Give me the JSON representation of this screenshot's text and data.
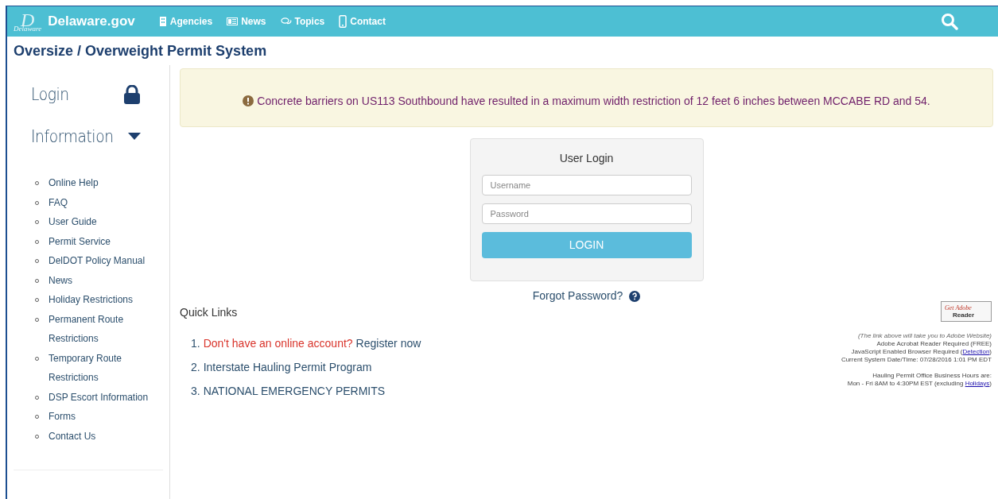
{
  "header": {
    "brand_mark": "D",
    "brand_sub": "Delaware",
    "brand": "Delaware.gov",
    "nav": [
      {
        "label": "Agencies"
      },
      {
        "label": "News"
      },
      {
        "label": "Topics"
      },
      {
        "label": "Contact"
      }
    ]
  },
  "page_title": "Oversize / Overweight Permit System",
  "sidebar": {
    "sections": [
      {
        "label": "Login"
      },
      {
        "label": "Information"
      }
    ],
    "items": [
      "Online Help",
      "FAQ",
      "User Guide",
      "Permit Service",
      "DelDOT Policy Manual",
      "News",
      "Holiday Restrictions",
      "Permanent Route Restrictions",
      "Temporary Route Restrictions",
      "DSP Escort Information",
      "Forms",
      "Contact Us"
    ]
  },
  "alert": {
    "text": "Concrete barriers on US113 Southbound have resulted in a maximum width restriction of 12 feet 6 inches between MCCABE RD and 54."
  },
  "login": {
    "title": "User Login",
    "username_placeholder": "Username",
    "password_placeholder": "Password",
    "button": "LOGIN",
    "forgot": "Forgot Password?"
  },
  "quick_links": {
    "title": "Quick Links",
    "items": [
      {
        "number": "1.",
        "prompt": "Don't have an online account?",
        "link": "Register now"
      },
      {
        "number": "2.",
        "link": "Interstate Hauling Permit Program"
      },
      {
        "number": "3.",
        "link": "NATIONAL EMERGENCY PERMITS"
      }
    ]
  },
  "adobe": {
    "badge_top": "Get Adobe",
    "badge_bottom": "Reader",
    "note": "(The link above will take you to Adobe Website)",
    "lines": [
      {
        "text": "Adobe Acrobat Reader Required (FREE)"
      },
      {
        "text": "JavaScript Enabled Browser Required (",
        "link": "Detection",
        "after": ")"
      },
      {
        "text": "Current System Date/Time: 07/28/2016 1:01 PM EDT"
      }
    ],
    "hours_title": "Hauling Permit Office Business Hours are:",
    "hours": "Mon - Fri 8AM to 4:30PM EST (excluding ",
    "hours_link": "Holidays",
    "hours_after": ")"
  }
}
